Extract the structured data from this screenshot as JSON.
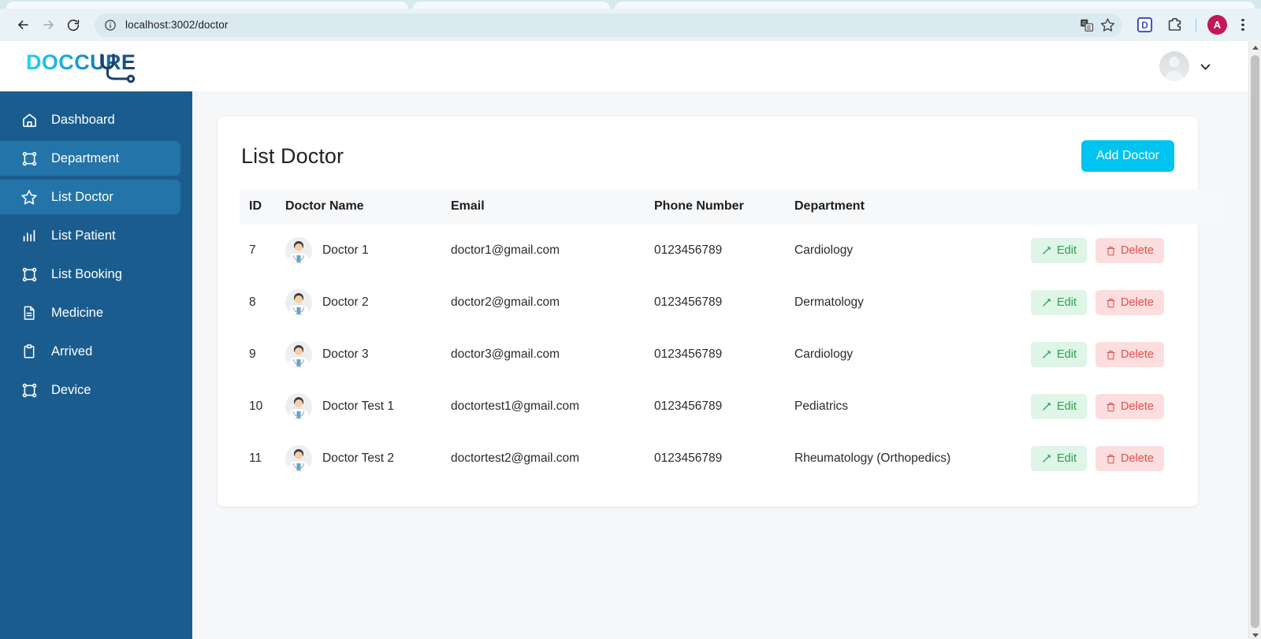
{
  "browser": {
    "back_label": "back-arrow",
    "forward_label": "forward-arrow",
    "reload_label": "reload",
    "url": "localhost:3002/doctor",
    "url_placeholder": "Search Google or type a URL",
    "translate_icon": "translate-icon",
    "bookmark_icon": "star-icon",
    "extension_d_label": "D",
    "extensions_icon": "puzzle-piece-icon",
    "profile_initial": "A",
    "menu_icon": "three-dot-menu-icon",
    "colors": {
      "toolbar_bg": "#e9f2f6",
      "omnibox_bg": "#dbe9f0",
      "profile_bg": "#c2185b",
      "extension_d_bg": "#3f51b5"
    }
  },
  "app": {
    "logo_text": "DOCCURE",
    "logo_colors": {
      "start": "#22d3ee",
      "end": "#1c3f6e"
    },
    "user_menu": {
      "avatar": "user-avatar",
      "caret": "⌄"
    }
  },
  "sidebar": {
    "bg": "#1b5c8e",
    "active_bg": "#2374a8",
    "items": [
      {
        "label": "Dashboard",
        "icon": "home-icon",
        "active": false
      },
      {
        "label": "Department",
        "icon": "frame-icon",
        "active": true
      },
      {
        "label": "List Doctor",
        "icon": "star-icon",
        "active": true
      },
      {
        "label": "List Patient",
        "icon": "bar-chart-icon",
        "active": false
      },
      {
        "label": "List Booking",
        "icon": "frame-icon",
        "active": false
      },
      {
        "label": "Medicine",
        "icon": "document-icon",
        "active": false
      },
      {
        "label": "Arrived",
        "icon": "clipboard-icon",
        "active": false
      },
      {
        "label": "Device",
        "icon": "frame-icon",
        "active": false
      }
    ]
  },
  "main": {
    "title": "List Doctor",
    "add_button": "Add Doctor",
    "add_button_color": "#00c3f0",
    "table": {
      "columns": [
        "ID",
        "Doctor Name",
        "Email",
        "Phone Number",
        "Department",
        ""
      ],
      "rows": [
        {
          "id": "7",
          "name": "Doctor 1",
          "email": "doctor1@gmail.com",
          "phone": "0123456789",
          "department": "Cardiology",
          "edit": "Edit",
          "delete": "Delete"
        },
        {
          "id": "8",
          "name": "Doctor 2",
          "email": "doctor2@gmail.com",
          "phone": "0123456789",
          "department": "Dermatology",
          "edit": "Edit",
          "delete": "Delete"
        },
        {
          "id": "9",
          "name": "Doctor 3",
          "email": "doctor3@gmail.com",
          "phone": "0123456789",
          "department": "Cardiology",
          "edit": "Edit",
          "delete": "Delete"
        },
        {
          "id": "10",
          "name": "Doctor Test 1",
          "email": "doctortest1@gmail.com",
          "phone": "0123456789",
          "department": "Pediatrics",
          "edit": "Edit",
          "delete": "Delete"
        },
        {
          "id": "11",
          "name": "Doctor Test 2",
          "email": "doctortest2@gmail.com",
          "phone": "0123456789",
          "department": "Rheumatology (Orthopedics)",
          "edit": "Edit",
          "delete": "Delete"
        }
      ]
    },
    "button_colors": {
      "edit_bg": "#dff5e7",
      "edit_fg": "#2aa14f",
      "delete_bg": "#fcdede",
      "delete_fg": "#e04f4f"
    }
  }
}
